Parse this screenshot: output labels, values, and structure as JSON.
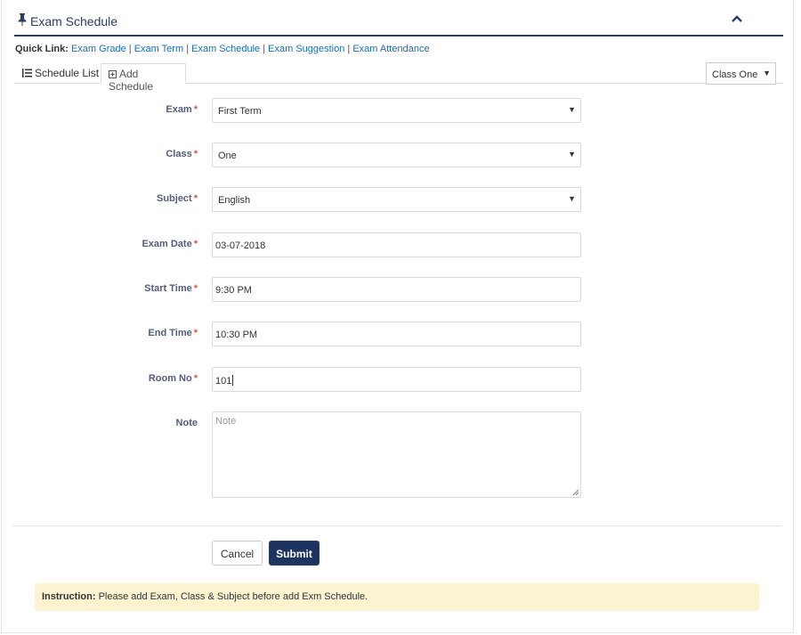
{
  "panel": {
    "title": "Exam Schedule",
    "icon": "pin-icon",
    "collapse_icon": "chevron-up-icon"
  },
  "quick_links": {
    "label": "Quick Link:",
    "links": [
      "Exam Grade",
      "Exam Term",
      "Exam Schedule",
      "Exam Suggestion",
      "Exam Attendance"
    ],
    "separator": "|"
  },
  "tabs": [
    {
      "label": "Schedule List",
      "icon": "list-icon",
      "active": false
    },
    {
      "label": "Add Schedule",
      "icon": "plus-square-icon",
      "active": true
    }
  ],
  "class_filter": {
    "selected": "Class One"
  },
  "form": {
    "required_mark": "*",
    "exam": {
      "label": "Exam",
      "value": "First Term"
    },
    "class": {
      "label": "Class",
      "value": "One"
    },
    "subject": {
      "label": "Subject",
      "value": "English"
    },
    "exam_date": {
      "label": "Exam Date",
      "value": "03-07-2018"
    },
    "start_time": {
      "label": "Start Time",
      "value": "9:30 PM"
    },
    "end_time": {
      "label": "End Time",
      "value": "10:30 PM"
    },
    "room_no": {
      "label": "Room No",
      "value": "101"
    },
    "note": {
      "label": "Note",
      "placeholder": "Note",
      "value": ""
    }
  },
  "buttons": {
    "cancel": "Cancel",
    "submit": "Submit"
  },
  "instruction": {
    "label": "Instruction:",
    "text": "Please add Exam, Class & Subject before add Exm Schedule."
  },
  "colors": {
    "primary": "#1d3461",
    "link": "#1b6fb5",
    "required": "#d9534f",
    "instruction_bg": "#fcf3d1"
  }
}
